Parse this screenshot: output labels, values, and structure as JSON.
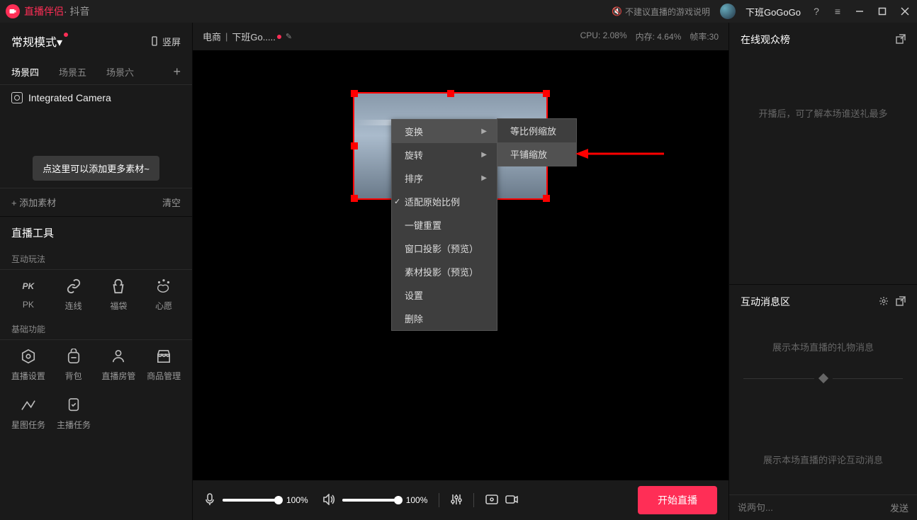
{
  "titlebar": {
    "app_name": "直播伴侣",
    "app_sub": " · 抖音",
    "notice": "不建议直播的游戏说明",
    "username": "下班GoGoGo"
  },
  "sidebar": {
    "mode_label": "常规模式",
    "orientation": "竖屏",
    "tabs": [
      "场景四",
      "场景五",
      "场景六"
    ],
    "source_name": "Integrated Camera",
    "add_hint": "点这里可以添加更多素材~",
    "add_material": "添加素材",
    "clear": "清空",
    "tools_header": "直播工具",
    "interactive_header": "互动玩法",
    "interactive": [
      {
        "id": "pk",
        "label": "PK"
      },
      {
        "id": "link",
        "label": "连线"
      },
      {
        "id": "bag",
        "label": "福袋"
      },
      {
        "id": "wish",
        "label": "心愿"
      }
    ],
    "basic_header": "基础功能",
    "basic": [
      {
        "id": "settings",
        "label": "直播设置"
      },
      {
        "id": "backpack",
        "label": "背包"
      },
      {
        "id": "room",
        "label": "直播房管"
      },
      {
        "id": "goods",
        "label": "商品管理"
      }
    ],
    "tasks": [
      {
        "id": "star",
        "label": "星图任务"
      },
      {
        "id": "anchor",
        "label": "主播任务"
      }
    ]
  },
  "preview": {
    "category": "电商",
    "title": "下班Go.....",
    "stats": {
      "cpu": "CPU: 2.08%",
      "mem": "内存: 4.64%",
      "fps": "帧率:30"
    }
  },
  "context_menu": {
    "items": [
      {
        "label": "变换",
        "submenu": true,
        "highlight": true
      },
      {
        "label": "旋转",
        "submenu": true
      },
      {
        "label": "排序",
        "submenu": true
      },
      {
        "label": "适配原始比例",
        "checked": true
      },
      {
        "label": "一键重置"
      },
      {
        "label": "窗口投影（预览）"
      },
      {
        "label": "素材投影（预览）"
      },
      {
        "label": "设置"
      },
      {
        "label": "删除"
      }
    ],
    "submenu": [
      {
        "label": "等比例缩放"
      },
      {
        "label": "平铺缩放",
        "highlight": true
      }
    ]
  },
  "bottom": {
    "mic_pct": "100%",
    "spk_pct": "100%",
    "start": "开始直播"
  },
  "right": {
    "audience_header": "在线观众榜",
    "audience_hint": "开播后，可了解本场谁送礼最多",
    "interact_header": "互动消息区",
    "gift_hint": "展示本场直播的礼物消息",
    "comment_hint": "展示本场直播的评论互动消息",
    "chat_placeholder": "说两句...",
    "send": "发送"
  }
}
